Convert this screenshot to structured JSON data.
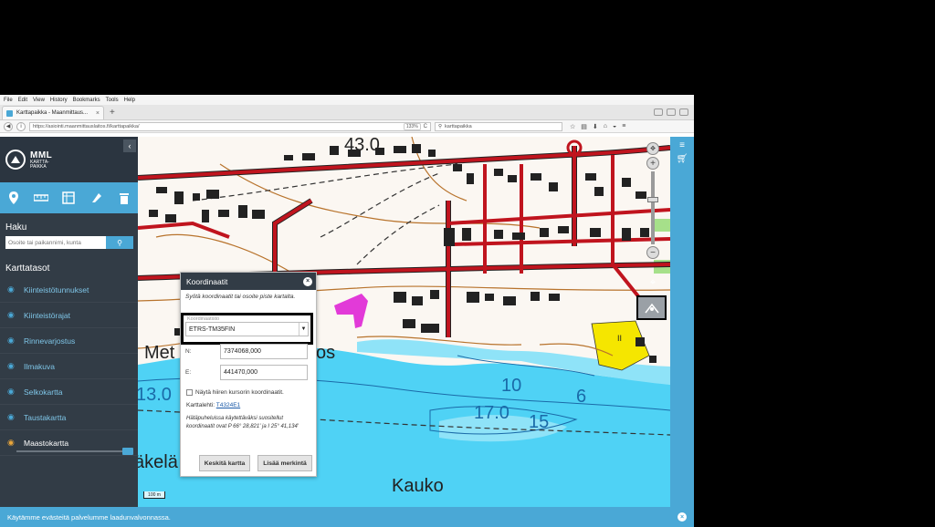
{
  "browser": {
    "menu": [
      "File",
      "Edit",
      "View",
      "History",
      "Bookmarks",
      "Tools",
      "Help"
    ],
    "tab_title": "Karttapaikka - Maanmittaus...",
    "tab_close": "×",
    "new_tab": "+",
    "url": "https://asiointi.maanmittauslaitos.fi/karttapaikka/",
    "zoom": "133%",
    "reload": "C",
    "search_value": "karttapaikka"
  },
  "sidebar": {
    "logo_title": "MML",
    "logo_sub1": "KARTTA-",
    "logo_sub2": "PAIKKA",
    "collapse": "‹",
    "search_heading": "Haku",
    "search_placeholder": "Osoite tai paikannimi, kunta",
    "layers_heading": "Karttatasot",
    "layers": [
      {
        "label": "Kiinteistötunnukset",
        "active": false
      },
      {
        "label": "Kiinteistörajat",
        "active": false
      },
      {
        "label": "Rinnevarjostus",
        "active": false
      },
      {
        "label": "Ilmakuva",
        "active": false
      },
      {
        "label": "Selkokartta",
        "active": false
      },
      {
        "label": "Taustakartta",
        "active": false
      },
      {
        "label": "Maastokartta",
        "active": true
      }
    ]
  },
  "map": {
    "labels": {
      "elev_top": "43.0",
      "place_left": "Met",
      "place_os": "os",
      "depth_130": "13.0",
      "depth_10": "10",
      "depth_6": "6",
      "depth_170": "17.0",
      "depth_15": "15",
      "place_kela": "äkelä",
      "place_kauko": "Kauko",
      "field_ii": "II"
    },
    "scale": "100 m"
  },
  "dialog": {
    "title": "Koordinaatit",
    "close": "×",
    "instruction": "Syötä koordinaatit tai osoite piste kartalta.",
    "cs_label": "Koordinaatisto",
    "cs_value": "ETRS-TM35FIN",
    "n_label": "N:",
    "n_value": "7374068,000",
    "e_label": "E:",
    "e_value": "441470,000",
    "checkbox_label": "Näytä hiiren kursorin koordinaatit.",
    "sheet_label": "Karttalehti:",
    "sheet_value": "T4324E1",
    "emergency": "Hätäpuheluissa käytettäväksi suositellut koordinaatit ovat P 66° 28,821' ja I 25° 41,134'",
    "btn_center": "Keskitä kartta",
    "btn_add": "Lisää merkintä"
  },
  "cookie": {
    "text": "Käytämme evästeitä palvelumme laadunvalvonnassa.",
    "close": "×"
  },
  "colors": {
    "sidebar": "#323c46",
    "accent": "#4aa8d6",
    "water": "#4fd2f5",
    "road": "#c0141e"
  }
}
